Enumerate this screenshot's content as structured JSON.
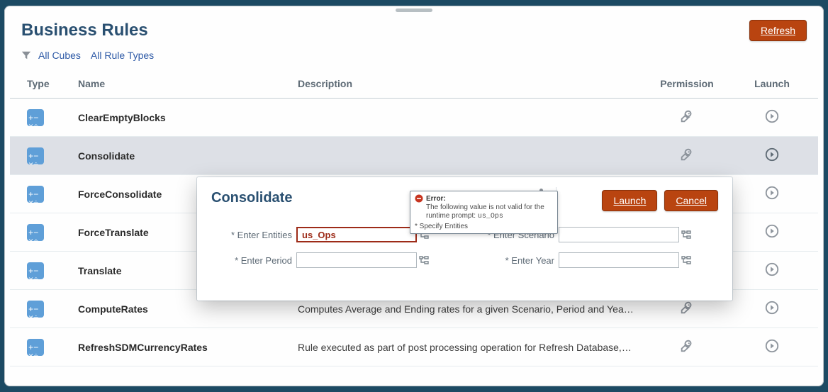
{
  "header": {
    "title": "Business Rules",
    "refresh_label": "Refresh"
  },
  "filter": {
    "cubes": "All Cubes",
    "rule_types": "All Rule Types"
  },
  "columns": {
    "type": "Type",
    "name": "Name",
    "description": "Description",
    "permission": "Permission",
    "launch": "Launch"
  },
  "rows": [
    {
      "name": "ClearEmptyBlocks",
      "description": "",
      "selected": false
    },
    {
      "name": "Consolidate",
      "description": "",
      "selected": true
    },
    {
      "name": "ForceConsolidate",
      "description": "",
      "selected": false
    },
    {
      "name": "ForceTranslate",
      "description": "",
      "selected": false
    },
    {
      "name": "Translate",
      "description": "",
      "selected": false
    },
    {
      "name": "ComputeRates",
      "description": "Computes Average and Ending rates for a given Scenario, Period and Year based on …",
      "selected": false
    },
    {
      "name": "RefreshSDMCurrencyRates",
      "description": "Rule executed as part of post processing operation for Refresh Database, Data Load, …",
      "selected": false
    }
  ],
  "dialog": {
    "title": "Consolidate",
    "launch_label": "Launch",
    "cancel_label": "Cancel",
    "fields": {
      "entities_label": "* Enter Entities",
      "entities_value": "us_Ops",
      "scenario_label": "* Enter Scenario",
      "scenario_value": "",
      "period_label": "* Enter Period",
      "period_value": "",
      "year_label": "* Enter Year",
      "year_value": ""
    },
    "error": {
      "heading": "Error:",
      "message_prefix": "The following value is not valid for the runtime prompt:",
      "message_token": "us_Ops",
      "footer": "* Specify Entities"
    }
  }
}
